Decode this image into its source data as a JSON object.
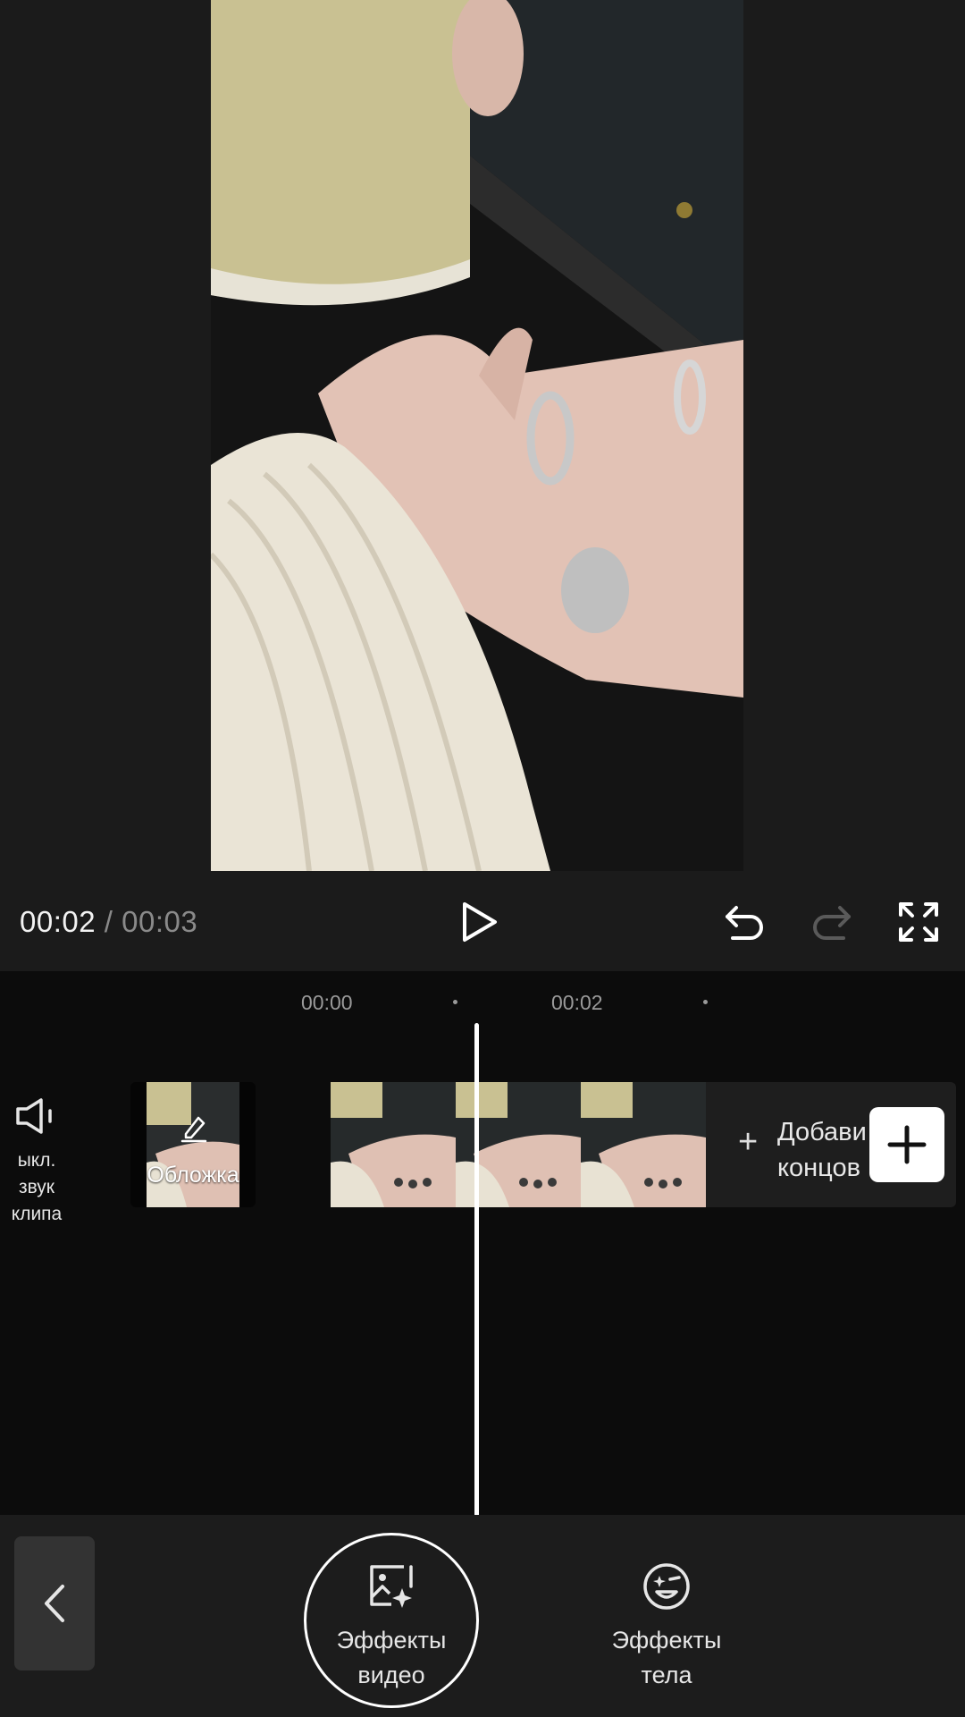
{
  "player": {
    "current_time": "00:02",
    "separator": "/",
    "total_time": "00:03"
  },
  "timeline": {
    "ruler": [
      "00:00",
      "00:02"
    ],
    "mute_label": "ыкл. звук\nклипа",
    "cover_label": "Обложка",
    "add_end_label": "Добави\nконцов"
  },
  "toolbar": {
    "tools": [
      {
        "label": "Эффекты\nвидео",
        "icon": "image-sparkle-icon",
        "selected": true
      },
      {
        "label": "Эффекты\nтела",
        "icon": "face-star-icon",
        "selected": false
      }
    ]
  },
  "colors": {
    "background": "#0c0c0c",
    "panel": "#1b1b1b",
    "bottom_bar": "#1c1c1c",
    "accent": "#ffffff",
    "muted_text": "#8a8a8a"
  }
}
